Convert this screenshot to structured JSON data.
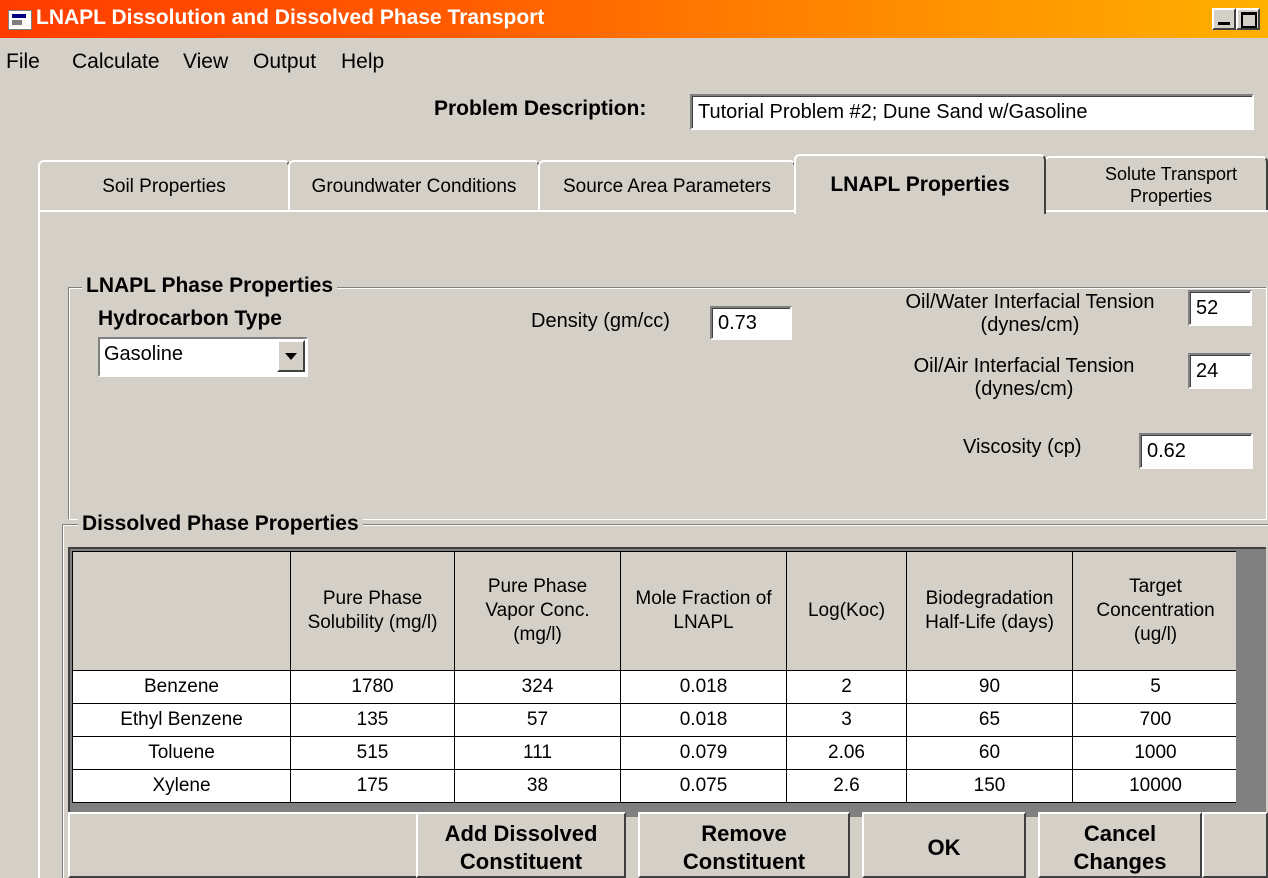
{
  "window": {
    "title": "LNAPL Dissolution and Dissolved Phase Transport"
  },
  "menu": [
    "File",
    "Calculate",
    "View",
    "Output",
    "Help"
  ],
  "problem": {
    "label": "Problem Description:",
    "value": "Tutorial Problem #2; Dune Sand w/Gasoline"
  },
  "tabs": [
    {
      "label": "Soil Properties"
    },
    {
      "label": "Groundwater Conditions"
    },
    {
      "label": "Source Area Parameters"
    },
    {
      "label": "LNAPL Properties",
      "active": true
    },
    {
      "label": "Solute Transport Properties"
    }
  ],
  "lnapl": {
    "group_title": "LNAPL Phase Properties",
    "hydrocarbon_label": "Hydrocarbon Type",
    "hydrocarbon_value": "Gasoline",
    "density_label": "Density (gm/cc)",
    "density_value": "0.73",
    "ow_tension_label_1": "Oil/Water Interfacial Tension",
    "ow_tension_label_2": "(dynes/cm)",
    "ow_tension_value": "52",
    "oa_tension_label_1": "Oil/Air Interfacial Tension",
    "oa_tension_label_2": "(dynes/cm)",
    "oa_tension_value": "24",
    "viscosity_label": "Viscosity (cp)",
    "viscosity_value": "0.62"
  },
  "dissolved": {
    "group_title": "Dissolved Phase Properties",
    "columns": [
      "",
      "Pure Phase Solubility (mg/l)",
      "Pure Phase Vapor Conc. (mg/l)",
      "Mole Fraction of LNAPL",
      "Log(Koc)",
      "Biodegradation Half-Life (days)",
      "Target Concentration (ug/l)"
    ],
    "rows": [
      [
        "Benzene",
        "1780",
        "324",
        "0.018",
        "2",
        "90",
        "5"
      ],
      [
        "Ethyl Benzene",
        "135",
        "57",
        "0.018",
        "3",
        "65",
        "700"
      ],
      [
        "Toluene",
        "515",
        "111",
        "0.079",
        "2.06",
        "60",
        "1000"
      ],
      [
        "Xylene",
        "175",
        "38",
        "0.075",
        "2.6",
        "150",
        "10000"
      ]
    ]
  },
  "buttons": {
    "add": "Add Dissolved Constituent",
    "remove": "Remove Constituent",
    "ok": "OK",
    "cancel": "Cancel Changes"
  }
}
